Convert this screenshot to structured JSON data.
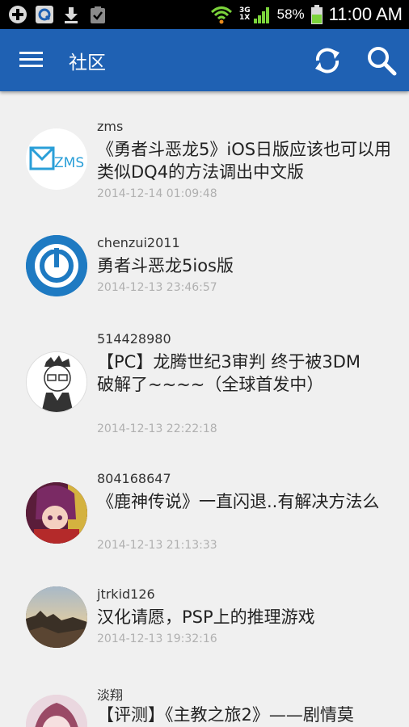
{
  "status_bar": {
    "network": [
      "3G",
      "1X"
    ],
    "battery_percent": "58%",
    "time": "11:00 AM",
    "left_icons": [
      "add-circle-icon",
      "q-app-icon",
      "download-icon",
      "clipboard-check-icon"
    ],
    "right_icons": [
      "wifi-icon",
      "signal-icon",
      "battery-icon"
    ]
  },
  "app_bar": {
    "title": "社区",
    "color": "#1f61b3",
    "icons": [
      "menu-icon",
      "refresh-icon",
      "search-icon"
    ]
  },
  "posts": [
    {
      "author": "zms",
      "title": "《勇者斗恶龙5》iOS日版应该也可以用类似DQ4的方法调出中文版",
      "date": "2014-12-14 01:09:48",
      "avatar_text": "ZMS"
    },
    {
      "author": "chenzui2011",
      "title": "勇者斗恶龙5ios版",
      "date": "2014-12-13 23:46:57"
    },
    {
      "author": "514428980",
      "title": "【PC】龙腾世纪3审判 终于被3DM破解了~~~~（全球首发中）",
      "date": "2014-12-13 22:22:18"
    },
    {
      "author": "804168647",
      "title": "《鹿神传说》一直闪退..有解决方法么",
      "date": "2014-12-13 21:13:33"
    },
    {
      "author": "jtrkid126",
      "title": "汉化请愿，PSP上的推理游戏",
      "date": "2014-12-13 19:32:16"
    },
    {
      "author": "淡翔",
      "title": "【评测】《主教之旅2》——剧情莫",
      "date": ""
    }
  ]
}
